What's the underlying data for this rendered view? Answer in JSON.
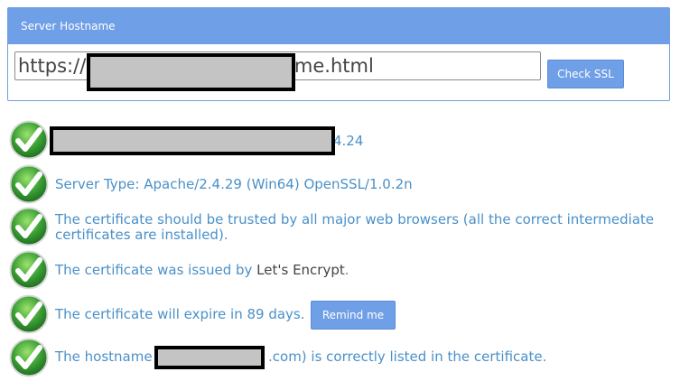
{
  "panel": {
    "title": "Server Hostname",
    "url_value": "https://              8920/web/home.html",
    "check_button": "Check SSL"
  },
  "results": {
    "row1_suffix": "4.24",
    "server_type": "Server Type: Apache/2.4.29 (Win64) OpenSSL/1.0.2n",
    "trusted_line1": "The certificate should be trusted by all major web browsers (all the correct intermediate",
    "trusted_line2": "certificates are installed).",
    "issued_prefix": "The certificate was issued by ",
    "issuer": "Let's Encrypt",
    "issued_suffix": ".",
    "expire": "The certificate will expire in 89 days.",
    "remind_button": "Remind me",
    "hostname_prefix": "The hostname ",
    "hostname_suffix": ".com) is correctly listed in the certificate."
  },
  "colors": {
    "accent": "#6f9fe6",
    "text_link": "#4a90c8",
    "check_green": "#43a047"
  },
  "icons": [
    "check-circle-icon"
  ]
}
